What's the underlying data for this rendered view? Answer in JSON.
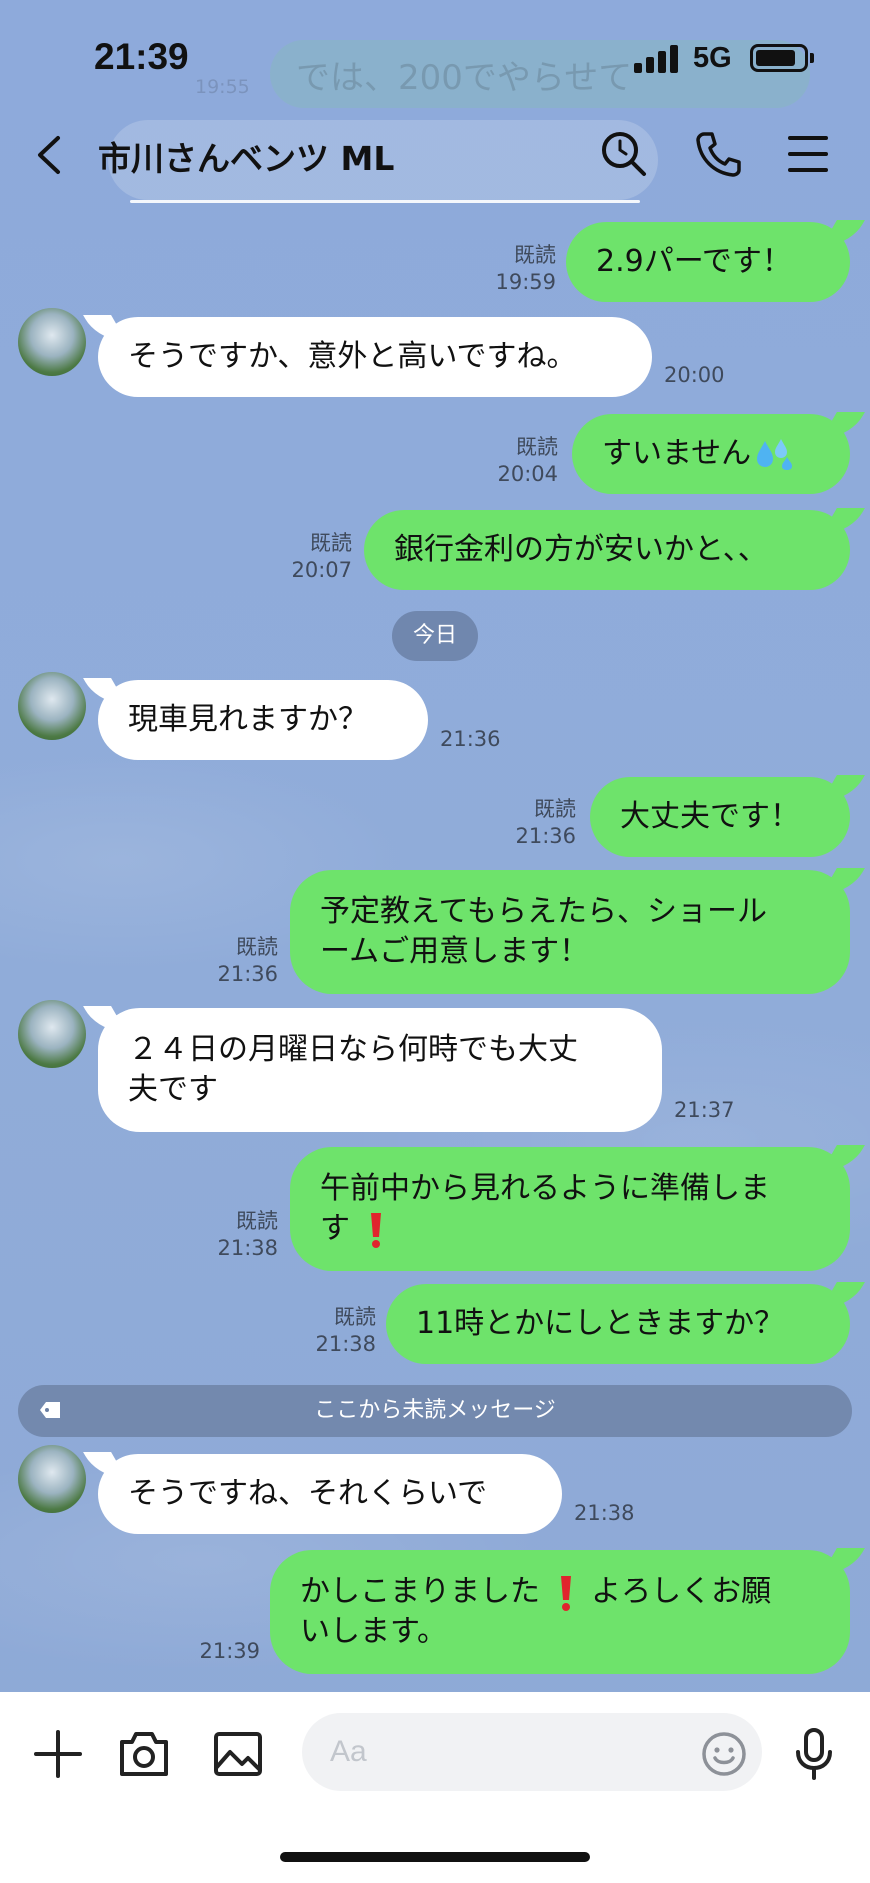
{
  "status_bar": {
    "time": "21:39",
    "network": "5G",
    "battery_level": 0.85,
    "behind_text": "では、200でやらせて",
    "behind_time": "19:55"
  },
  "header": {
    "back_icon": "chevron-left-icon",
    "title": "市川さんベンツ ML",
    "icons": [
      "search-icon",
      "phone-icon",
      "menu-icon"
    ]
  },
  "day_separator": "今日",
  "unread_separator": "ここから未読メッセージ",
  "messages": [
    {
      "side": "out",
      "text": "2.9パーです！",
      "read": "既読",
      "time": "19:59"
    },
    {
      "side": "in",
      "text": "そうですか、意外と高いですね。",
      "time": "20:00"
    },
    {
      "side": "out",
      "text": "すいません",
      "emoji": "sweat-drops-icon",
      "read": "既読",
      "time": "20:04"
    },
    {
      "side": "out",
      "text": "銀行金利の方が安いかと、、",
      "read": "既読",
      "time": "20:07"
    },
    {
      "side": "in",
      "text": "現車見れますか？",
      "time": "21:36"
    },
    {
      "side": "out",
      "text": "大丈夫です！",
      "read": "既読",
      "time": "21:36"
    },
    {
      "side": "out",
      "line1": "予定教えてもらえたら、ショール",
      "line2": "ームご用意します！",
      "read": "既読",
      "time": "21:36"
    },
    {
      "side": "in",
      "line1": "２４日の月曜日なら何時でも大丈",
      "line2": "夫です",
      "time": "21:37"
    },
    {
      "side": "out",
      "line1": "午前中から見れるように準備しま",
      "line2": "す",
      "emoji": "exclamation-icon",
      "read": "既読",
      "time": "21:38"
    },
    {
      "side": "out",
      "text": "11時とかにしときますか？",
      "read": "既読",
      "time": "21:38"
    },
    {
      "side": "in",
      "text": "そうですね、それくらいで",
      "time": "21:38"
    },
    {
      "side": "out",
      "line1a": "かしこまりました",
      "line1b": "よろしくお願",
      "line2": "いします。",
      "emoji": "exclamation-icon",
      "time": "21:39"
    }
  ],
  "input": {
    "placeholder": "Aa",
    "value": ""
  },
  "bottom_icons": [
    "plus-icon",
    "camera-icon",
    "image-icon",
    "emoji-icon",
    "mic-icon"
  ],
  "colors": {
    "background": "#8fabd9",
    "outgoing_bubble": "#6ee36b",
    "incoming_bubble": "#ffffff"
  }
}
